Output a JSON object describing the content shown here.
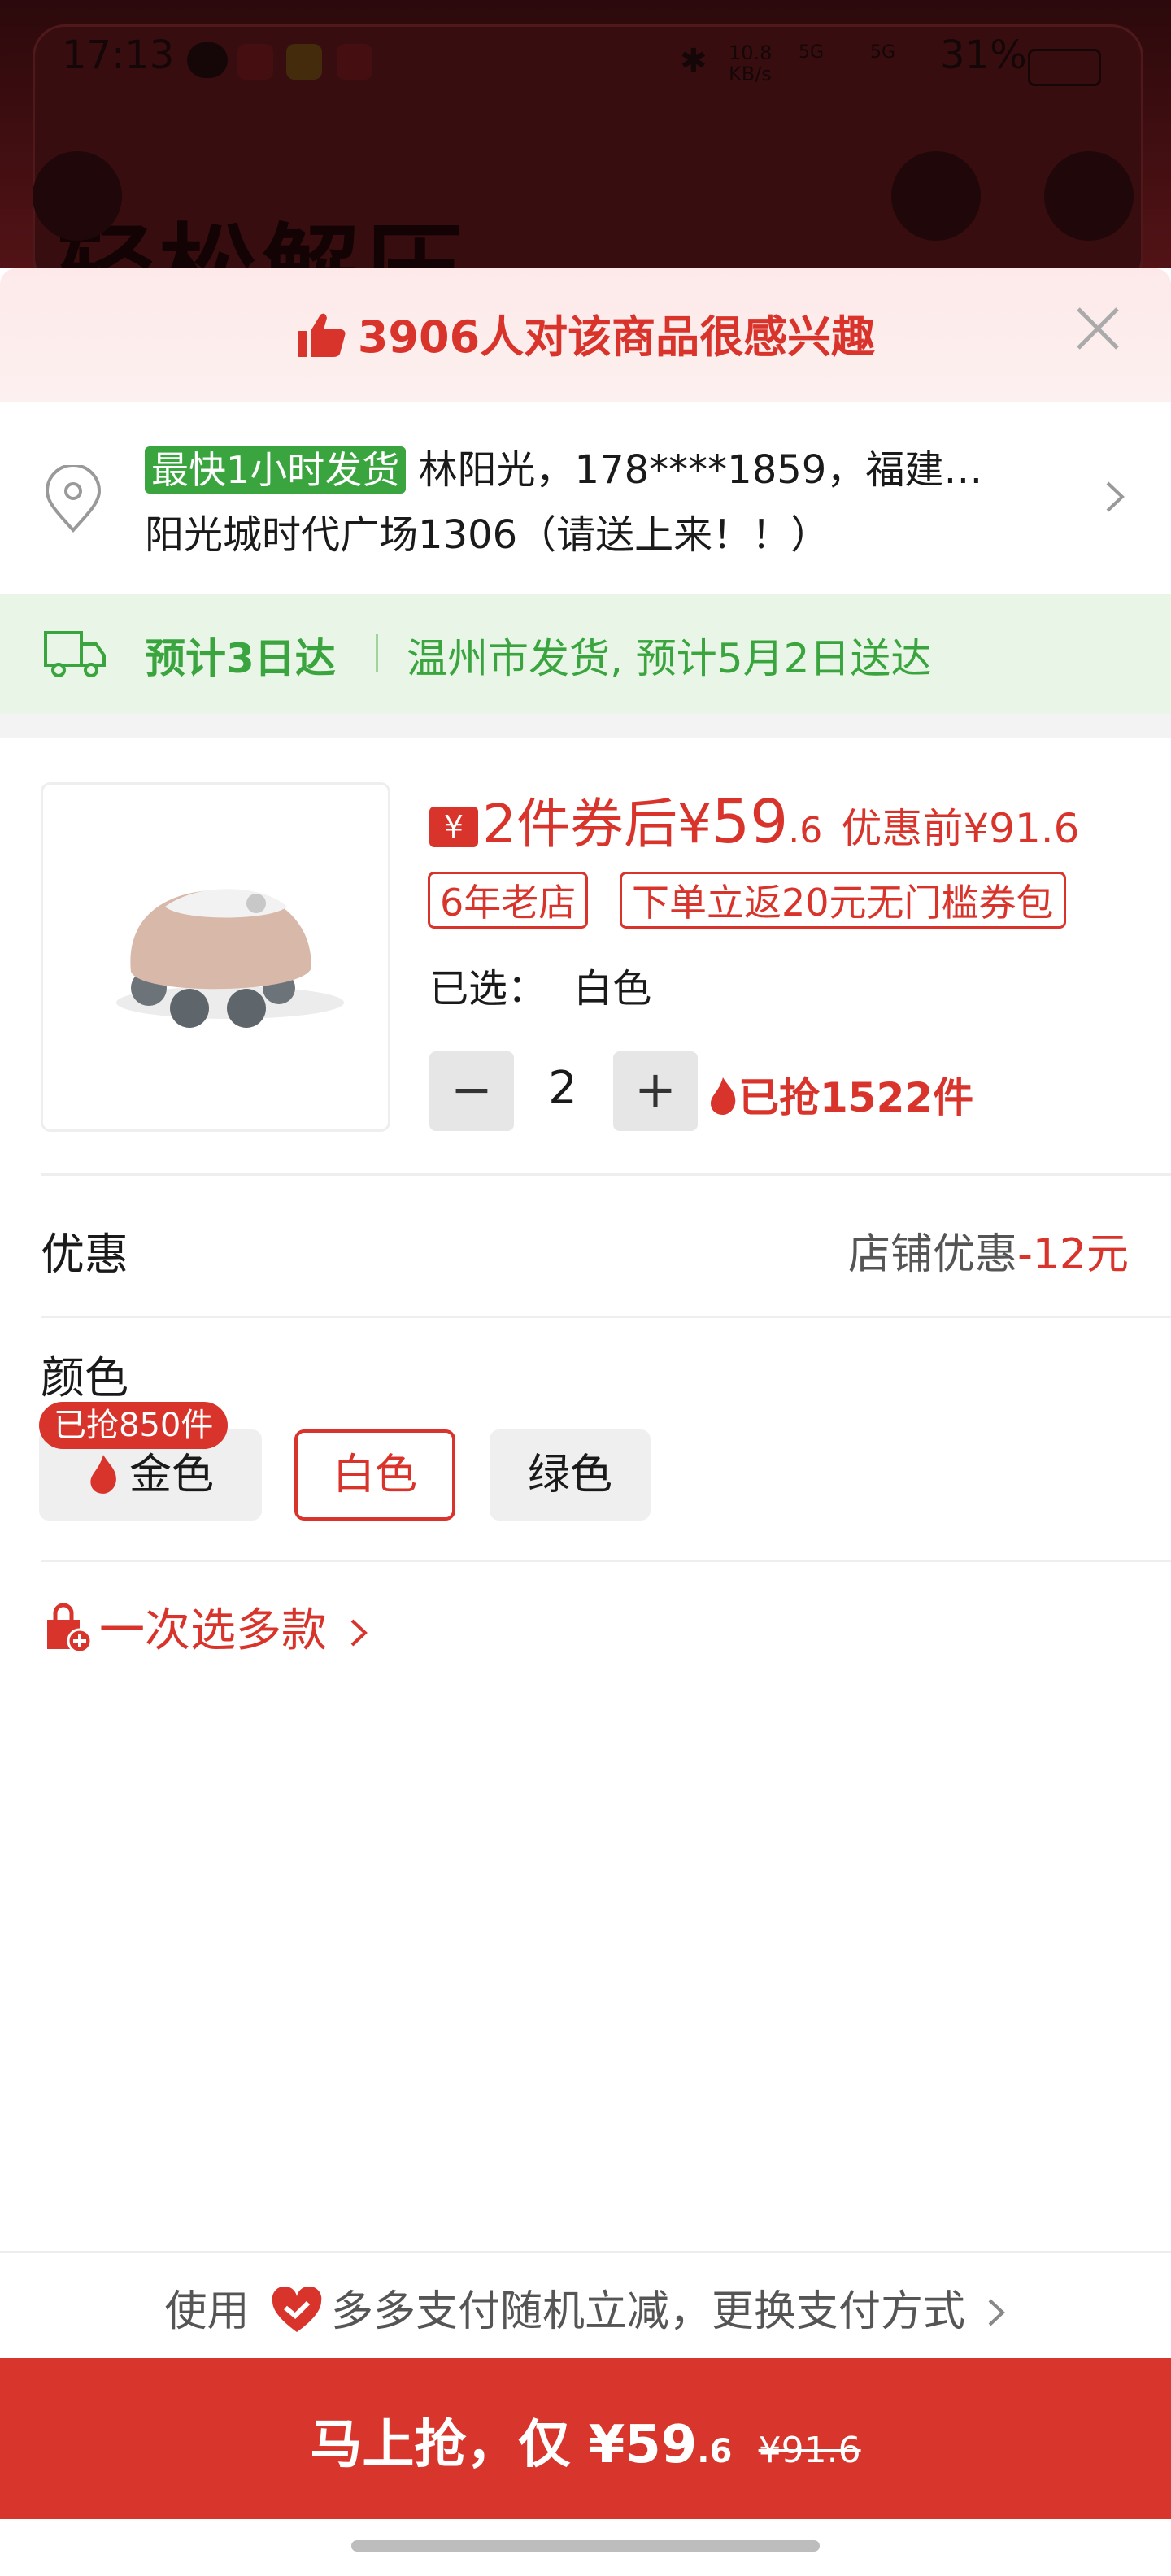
{
  "status_bar": {
    "time": "17:13",
    "speed": "10.8 KB/s",
    "network1": "5G",
    "network2": "5G",
    "battery": "31%"
  },
  "background_header": {
    "title_text": "轻松解压"
  },
  "interest_banner": {
    "text": "3906人对该商品很感兴趣"
  },
  "address": {
    "fast_tag": "最快1小时发货",
    "line1": "林阳光，178****1859，福建…",
    "line2": "阳光城时代广场1306（请送上来！！）"
  },
  "shipping": {
    "estimate": "预计3日达",
    "detail": "温州市发货, 预计5月2日送达"
  },
  "product": {
    "coupon_price_label": "2件券后",
    "price_currency": "¥",
    "price_int": "59",
    "price_dec": ".6",
    "original_price_label": "优惠前¥91.6",
    "tag_shop": "6年老店",
    "tag_coupon": "下单立返20元无门槛券包",
    "selected_label": "已选：",
    "selected_value": "白色",
    "quantity": "2",
    "minus": "−",
    "plus": "+",
    "sold_text": "已抢1522件"
  },
  "promotion": {
    "label": "优惠",
    "right_text": "店铺优惠",
    "right_amount": "-12元"
  },
  "color": {
    "label": "颜色",
    "badge": "已抢850件",
    "options": [
      {
        "label": "金色"
      },
      {
        "label": "白色"
      },
      {
        "label": "绿色"
      }
    ]
  },
  "multi_select": {
    "label": "一次选多款"
  },
  "payment": {
    "prefix": "使用",
    "text": "多多支付随机立减，更换支付方式"
  },
  "buy_button": {
    "label": "马上抢，仅 ¥59",
    "decimal": ".6",
    "original": "¥91.6"
  },
  "colors": {
    "accent": "#d9342b",
    "green": "#3aa53f"
  }
}
